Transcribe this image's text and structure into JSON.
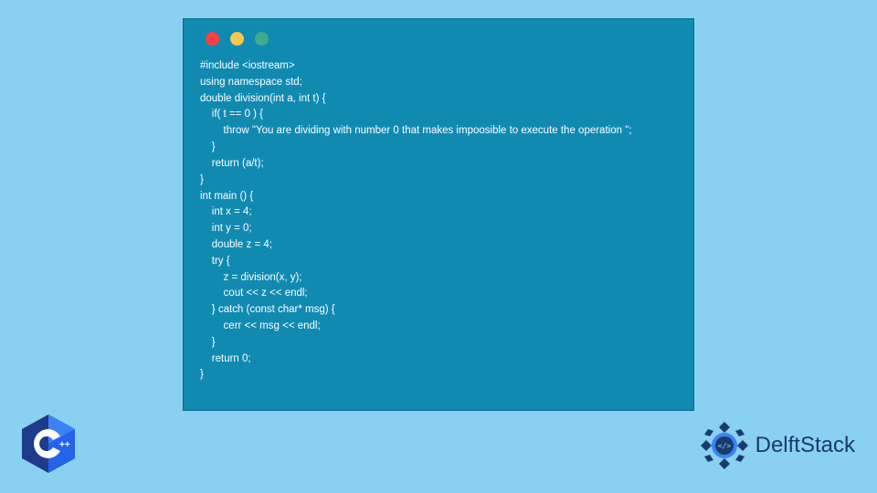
{
  "window": {
    "traffic_lights": [
      "red",
      "yellow",
      "green"
    ]
  },
  "code_lines": [
    "#include <iostream>",
    "using namespace std;",
    "double division(int a, int t) {",
    "    if( t == 0 ) {",
    "        throw \"You are dividing with number 0 that makes impoosible to execute the operation \";",
    "    }",
    "    return (a/t);",
    "}",
    "int main () {",
    "    int x = 4;",
    "    int y = 0;",
    "    double z = 4;",
    "    try {",
    "        z = division(x, y);",
    "        cout << z << endl;",
    "    } catch (const char* msg) {",
    "        cerr << msg << endl;",
    "    }",
    "    return 0;",
    "}"
  ],
  "badges": {
    "cpp_label": "C++",
    "brand": "DelftStack"
  },
  "colors": {
    "page_bg": "#88d1f1",
    "window_bg": "#118ab2",
    "code_text": "#ffffff",
    "dot_red": "#f94144",
    "dot_yellow": "#f9c74f",
    "dot_green": "#43aa8b",
    "brand_text": "#1a3a6e"
  }
}
